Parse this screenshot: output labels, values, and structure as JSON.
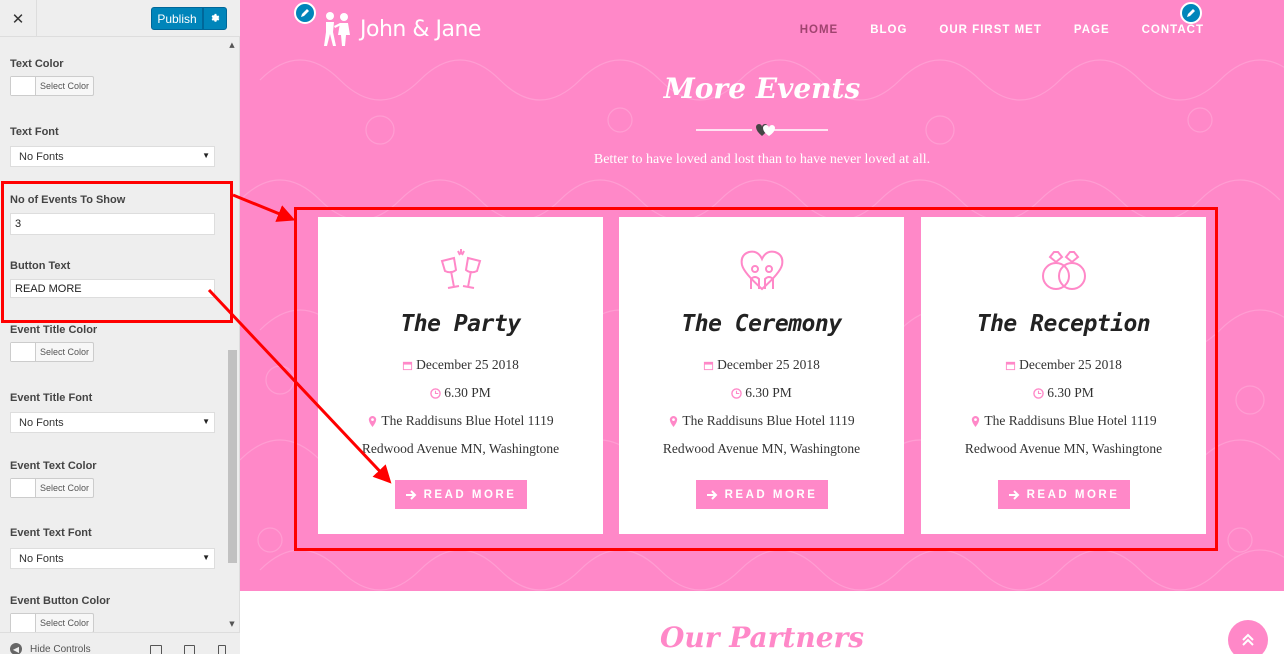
{
  "sidebar": {
    "close_label": "✕",
    "publish_label": "Publish",
    "fields": {
      "text_color_label": "Text Color",
      "text_color_button": "Select Color",
      "text_font_label": "Text Font",
      "text_font_value": "No Fonts",
      "events_count_label": "No of Events To Show",
      "events_count_value": "3",
      "button_text_label": "Button Text",
      "button_text_value": "READ MORE",
      "event_title_color_label": "Event Title Color",
      "event_title_color_button": "Select Color",
      "event_title_font_label": "Event Title Font",
      "event_title_font_value": "No Fonts",
      "event_text_color_label": "Event Text Color",
      "event_text_color_button": "Select Color",
      "event_text_font_label": "Event Text Font",
      "event_text_font_value": "No Fonts",
      "event_button_color_label": "Event Button Color",
      "event_button_color_button": "Select Color"
    },
    "footer": {
      "hide_controls": "Hide Controls"
    }
  },
  "preview": {
    "logo_text": "John & Jane",
    "nav": [
      "HOME",
      "BLOG",
      "OUR FIRST MET",
      "PAGE",
      "CONTACT"
    ],
    "events_title": "More Events",
    "events_subtitle": "Better to have loved and lost than to have never loved at all.",
    "events": [
      {
        "title": "The Party",
        "date": "December 25 2018",
        "time": "6.30 PM",
        "address1": "The Raddisuns Blue Hotel 1119",
        "address2": "Redwood Avenue MN, Washingtone",
        "button": "READ MORE",
        "icon": "toast-glasses-icon"
      },
      {
        "title": "The Ceremony",
        "date": "December 25 2018",
        "time": "6.30 PM",
        "address1": "The Raddisuns Blue Hotel 1119",
        "address2": "Redwood Avenue MN, Washingtone",
        "button": "READ MORE",
        "icon": "couple-heart-icon"
      },
      {
        "title": "The Reception",
        "date": "December 25 2018",
        "time": "6.30 PM",
        "address1": "The Raddisuns Blue Hotel 1119",
        "address2": "Redwood Avenue MN, Washingtone",
        "button": "READ MORE",
        "icon": "wedding-rings-icon"
      }
    ],
    "partners_title": "Our Partners"
  },
  "colors": {
    "brand_pink": "#ff88c8",
    "publish_blue": "#0085ba",
    "highlight_red": "#ff0000",
    "nav_active": "#a0436f"
  }
}
